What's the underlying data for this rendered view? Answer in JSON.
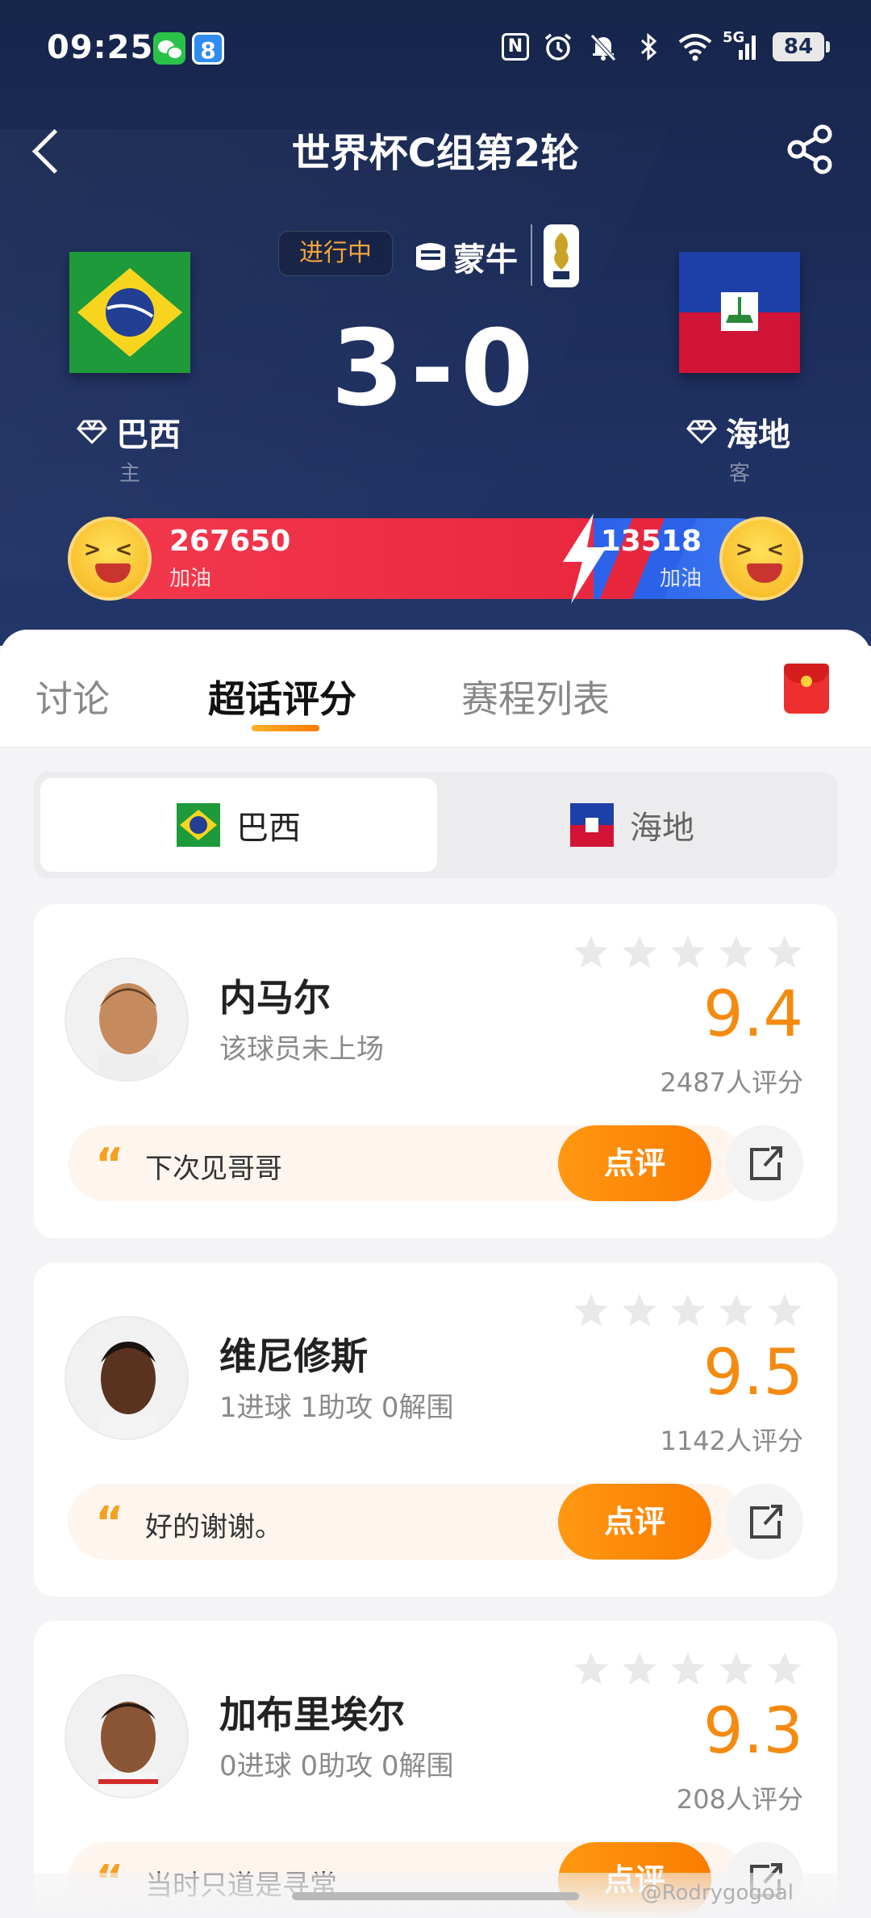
{
  "status_bar": {
    "time": "09:25",
    "app_badge": "8",
    "nfc": "N",
    "network": "5G",
    "battery": "84"
  },
  "nav": {
    "title": "世界杯C组第2轮"
  },
  "match": {
    "status": "进行中",
    "sponsor": "蒙牛",
    "score": "3-0",
    "home": {
      "name": "巴西",
      "role": "主"
    },
    "away": {
      "name": "海地",
      "role": "客"
    }
  },
  "cheer": {
    "home_count": "267650",
    "home_label": "加油",
    "away_count": "13518",
    "away_label": "加油"
  },
  "tabs": [
    {
      "label": "讨论"
    },
    {
      "label": "超话评分"
    },
    {
      "label": "赛程列表"
    }
  ],
  "team_toggle": {
    "home": "巴西",
    "away": "海地"
  },
  "players": [
    {
      "name": "内马尔",
      "detail": "该球员未上场",
      "score": "9.4",
      "raters": "2487人评分",
      "comment": "下次见哥哥",
      "review_label": "点评"
    },
    {
      "name": "维尼修斯",
      "detail": "1进球 1助攻 0解围",
      "score": "9.5",
      "raters": "1142人评分",
      "comment": "好的谢谢。",
      "review_label": "点评"
    },
    {
      "name": "加布里埃尔",
      "detail": "0进球 0助攻 0解围",
      "score": "9.3",
      "raters": "208人评分",
      "comment": "当时只道是寻常",
      "review_label": "点评"
    }
  ],
  "watermark": "@Rodrygogoal",
  "colors": {
    "accent_orange": "#f58a10",
    "header_navy": "#1c2d5b",
    "home_red": "#e8263e",
    "away_blue": "#2c62ea"
  }
}
